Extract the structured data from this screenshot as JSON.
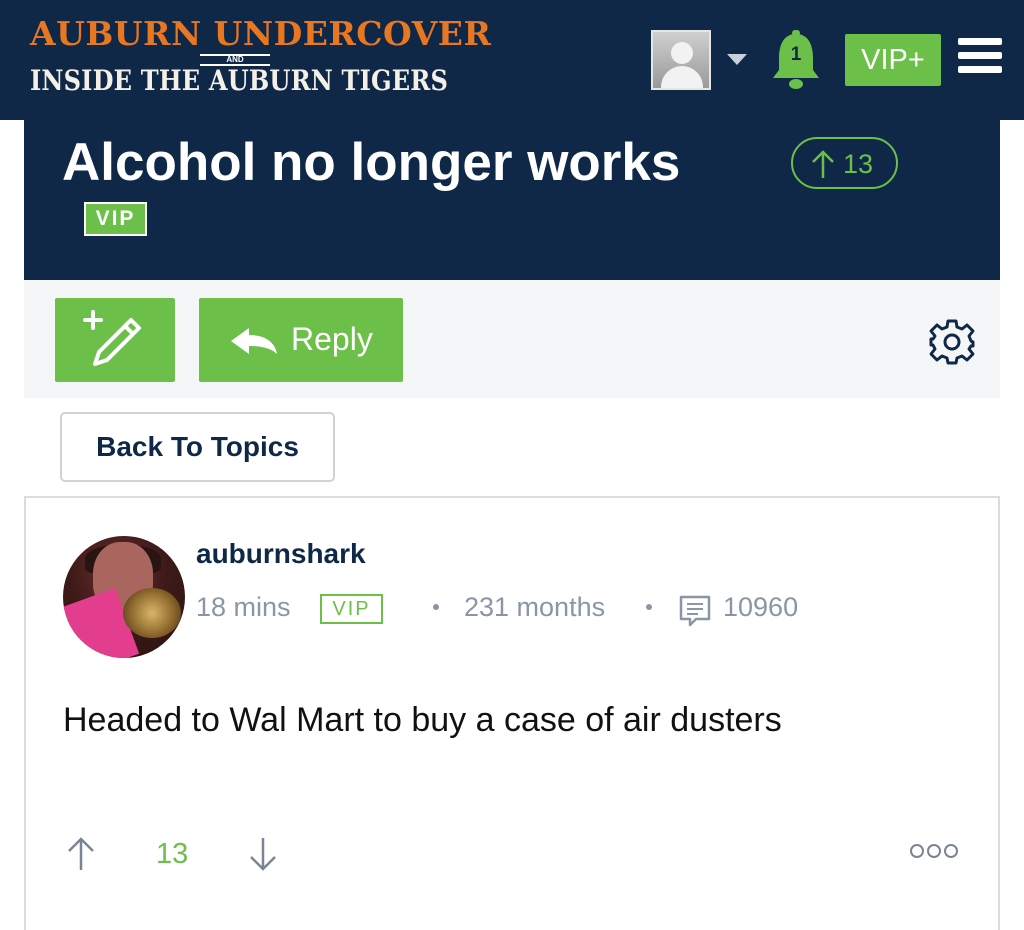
{
  "header": {
    "logo_line1": "Auburn Undercover",
    "logo_and": "AND",
    "logo_line2": "Inside The Auburn Tigers",
    "notification_count": "1",
    "vip_button": "VIP+"
  },
  "topic": {
    "title": "Alcohol no longer works",
    "score": "13",
    "badge": "VIP"
  },
  "actions": {
    "reply_label": "Reply",
    "back_label": "Back To Topics"
  },
  "post": {
    "username": "auburnshark",
    "time": "18 mins",
    "badge": "VIP",
    "tenure": "231 months",
    "post_count": "10960",
    "body": "Headed to Wal Mart to buy a case of air dusters",
    "votes": "13"
  },
  "colors": {
    "navy": "#0f2848",
    "green": "#6cc04a",
    "orange": "#e87722",
    "meta_gray": "#8a96a6"
  },
  "icons": [
    "user-avatar-placeholder-icon",
    "caret-down-icon",
    "bell-icon",
    "hamburger-menu-icon",
    "arrow-up-icon",
    "new-topic-pencil-icon",
    "reply-arrow-icon",
    "gear-icon",
    "comment-icon",
    "arrow-down-icon",
    "more-options-icon"
  ]
}
